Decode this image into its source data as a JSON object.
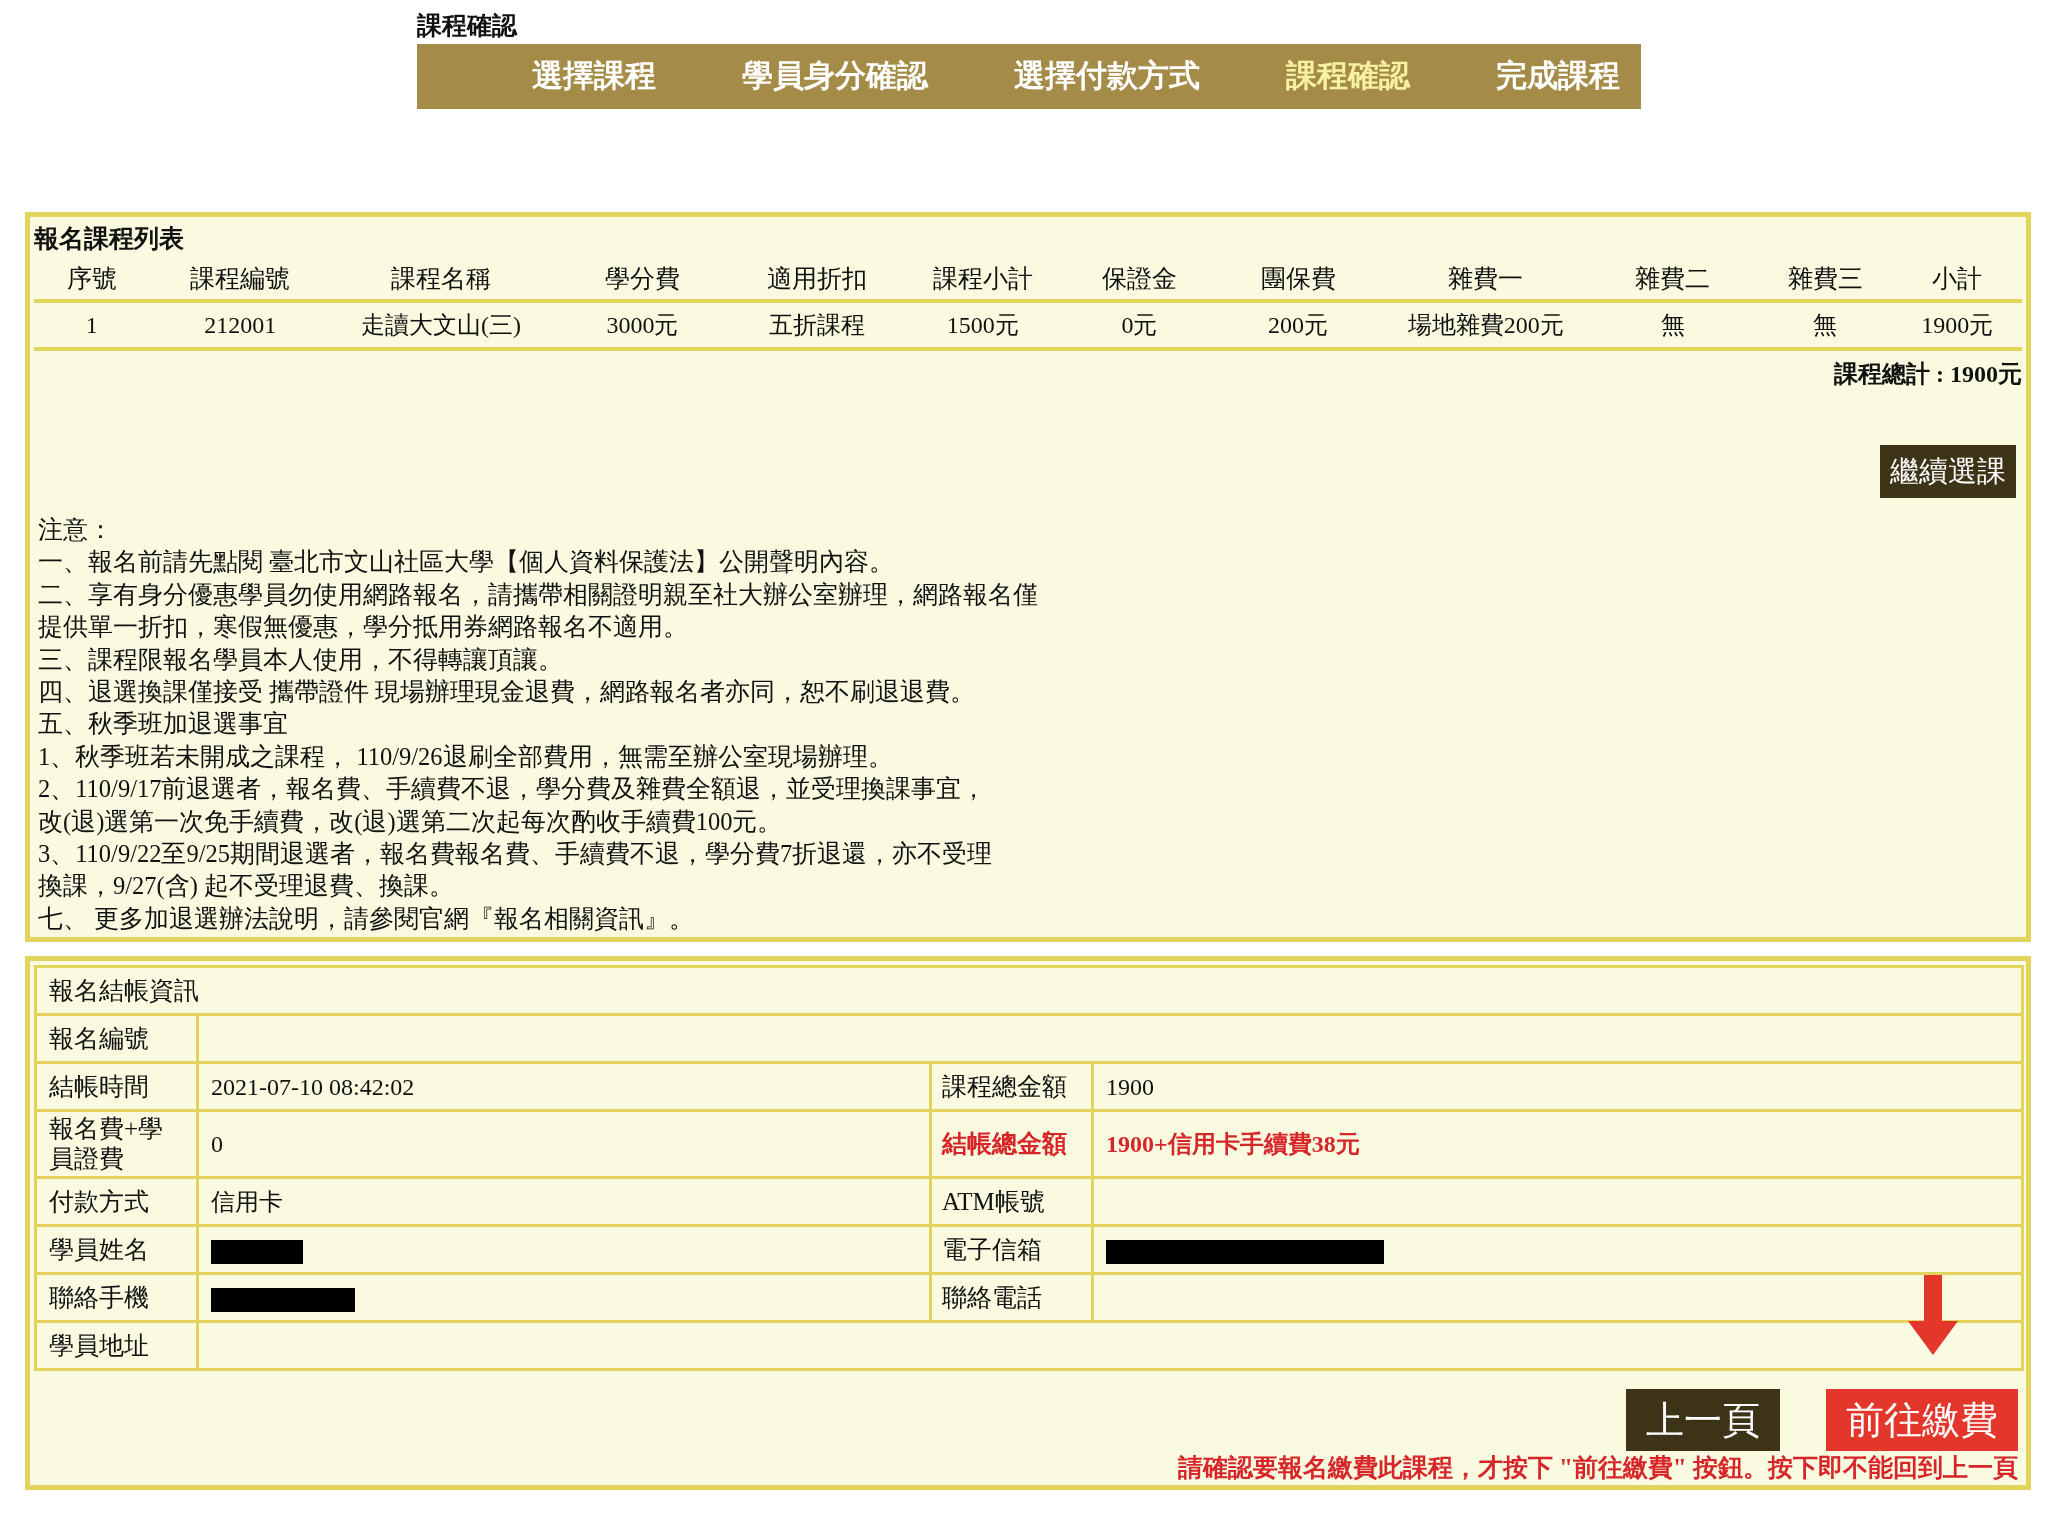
{
  "page_title": "課程確認",
  "steps": [
    {
      "label": "選擇課程",
      "selected": false
    },
    {
      "label": "學員身分確認",
      "selected": false
    },
    {
      "label": "選擇付款方式",
      "selected": false
    },
    {
      "label": "課程確認",
      "selected": true
    },
    {
      "label": "完成課程",
      "selected": false
    }
  ],
  "course_list": {
    "title": "報名課程列表",
    "columns": [
      "序號",
      "課程編號",
      "課程名稱",
      "學分費",
      "適用折扣",
      "課程小計",
      "保證金",
      "團保費",
      "雜費一",
      "雜費二",
      "雜費三",
      "小計"
    ],
    "rows": [
      [
        "1",
        "212001",
        "走讀大文山(三)",
        "3000元",
        "五折課程",
        "1500元",
        "0元",
        "200元",
        "場地雜費200元",
        "無",
        "無",
        "1900元"
      ]
    ],
    "total": "課程總計 : 1900元",
    "continue_button": "繼續選課"
  },
  "notes": [
    "注意：",
    "一、報名前請先點閱 臺北市文山社區大學【個人資料保護法】公開聲明內容。",
    "二、享有身分優惠學員勿使用網路報名，請攜帶相關證明親至社大辦公室辦理，網路報名僅",
    "提供單一折扣，寒假無優惠，學分抵用券網路報名不適用。",
    "三、課程限報名學員本人使用，不得轉讓頂讓。",
    "四、退選換課僅接受 攜帶證件 現場辦理現金退費，網路報名者亦同，恕不刷退退費。",
    "五、秋季班加退選事宜",
    "1、秋季班若未開成之課程， 110/9/26退刷全部費用，無需至辦公室現場辦理。",
    "2、110/9/17前退選者，報名費、手續費不退，學分費及雜費全額退，並受理換課事宜，",
    "改(退)選第一次免手續費，改(退)選第二次起每次酌收手續費100元。",
    "3、110/9/22至9/25期間退選者，報名費報名費、手續費不退，學分費7折退還，亦不受理",
    "換課，9/27(含)  起不受理退費、換課。",
    "七、 更多加退選辦法說明，請參閱官網『報名相關資訊』。"
  ],
  "checkout": {
    "title": "報名結帳資訊",
    "rows": [
      [
        {
          "label": "報名編號",
          "highlight": false,
          "redacted": false
        }
      ],
      [
        {
          "label": "結帳時間",
          "value": "2021-07-10 08:42:02",
          "highlight": false,
          "redacted": false
        },
        {
          "label": "課程總金額",
          "value": "1900",
          "highlight": false,
          "redacted": false
        }
      ],
      [
        {
          "label": "報名費+學員證費",
          "value": "0",
          "highlight": false,
          "redacted": false
        },
        {
          "label": "結帳總金額",
          "value": "1900+信用卡手續費38元",
          "highlight": true,
          "redacted": false
        }
      ],
      [
        {
          "label": "付款方式",
          "value": "信用卡",
          "highlight": false,
          "redacted": false
        },
        {
          "label": "ATM帳號",
          "highlight": false,
          "redacted": false
        }
      ],
      [
        {
          "label": "學員姓名",
          "highlight": false,
          "redacted": true
        },
        {
          "label": "電子信箱",
          "highlight": false,
          "redacted": true
        }
      ],
      [
        {
          "label": "聯絡手機",
          "highlight": false,
          "redacted": true
        },
        {
          "label": "聯絡電話",
          "highlight": false,
          "redacted": false
        }
      ],
      [
        {
          "label": "學員地址",
          "highlight": false,
          "redacted": false
        }
      ]
    ]
  },
  "buttons": [
    {
      "label": "上一頁",
      "kind": "back"
    },
    {
      "label": "前往繳費",
      "kind": "pay"
    }
  ],
  "warning": "請確認要報名繳費此課程，才按下 \"前往繳費\" 按鈕。按下即不能回到上一頁"
}
